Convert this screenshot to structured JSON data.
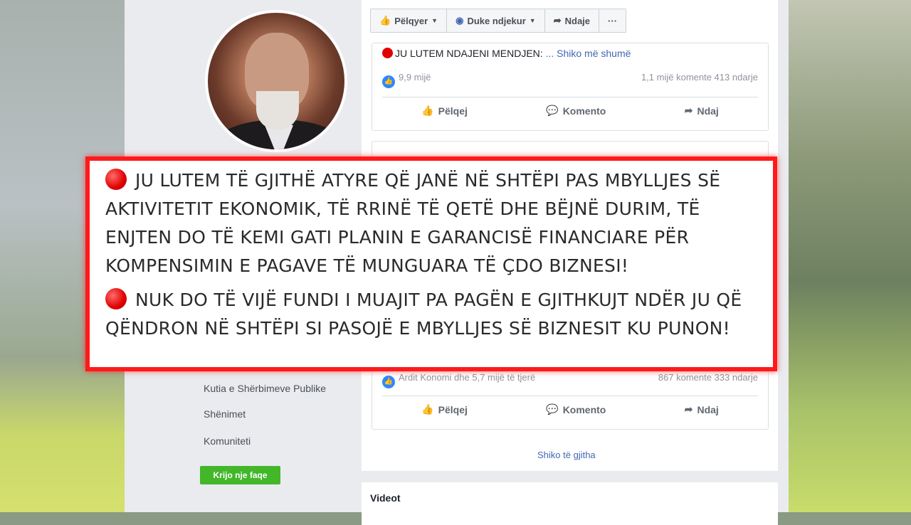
{
  "page_header": {
    "liked_label": "Pëlqyer",
    "following_label": "Duke ndjekur",
    "share_label": "Ndaje",
    "more_label": "···"
  },
  "post1": {
    "text": "JU LUTEM NDAJENI MENDJEN:",
    "see_more": "... Shiko më shumë",
    "reactions": "9,9 mijë",
    "comments_shares": "1,1 mijë komente  413 ndarje"
  },
  "actions": {
    "like": "Pëlqej",
    "comment": "Komento",
    "share": "Ndaj"
  },
  "post2": {
    "reactions": "Ardit Konomi dhe 5,7 mijë të tjerë",
    "comments_shares": "867 komente  333 ndarje"
  },
  "sidebar": {
    "items": [
      "Kutia e Shërbimeve Publike",
      "Shënimet",
      "Komuniteti"
    ],
    "create_page": "Krijo nje faqe"
  },
  "see_all": "Shiko të gjitha",
  "videos_title": "Videot",
  "overlay": {
    "paragraph1": "JU LUTEM TË GJITHË ATYRE QË JANË NË SHTËPI PAS MBYLLJES SË AKTIVITETIT EKONOMIK, TË RRINË TË QETË DHE BËJNË DURIM, TË ENJTEN DO TË KEMI GATI PLANIN E GARANCISË FINANCIARE PËR KOMPENSIMIN E PAGAVE TË MUNGUARA TË ÇDO BIZNESI!",
    "paragraph2": "NUK DO TË VIJË FUNDI I MUAJIT PA PAGËN E GJITHKUJT NDËR JU QË QËNDRON NË SHTËPI SI PASOJË E MBYLLJES SË BIZNESIT KU PUNON!"
  },
  "colors": {
    "overlay_border": "#ff1a1a",
    "link": "#4267b2",
    "create_button": "#42b72a"
  }
}
